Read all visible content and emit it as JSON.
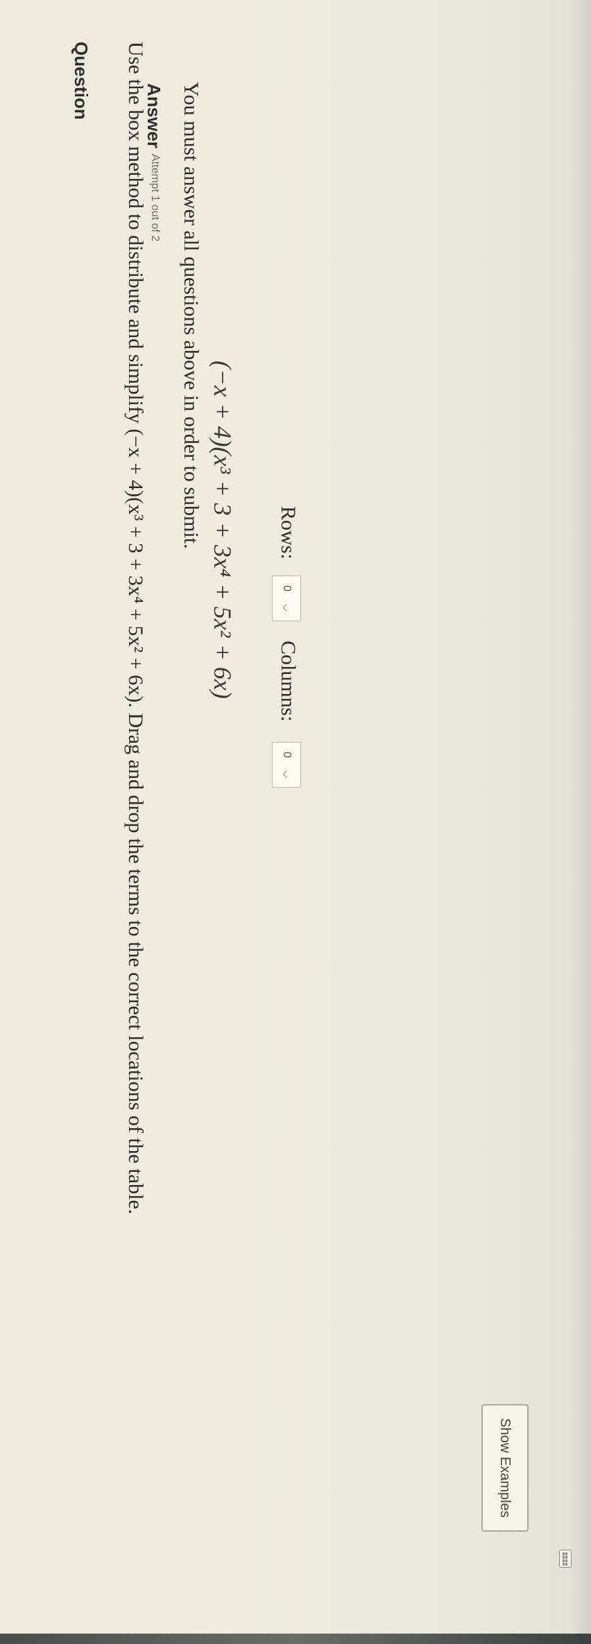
{
  "question": {
    "header": "Question",
    "show_examples_label": "Show Examples",
    "instruction_text": "Use the box method to distribute and simplify (−x + 4)(x³ + 3 + 3x⁴ + 5x² + 6x). Drag and drop the terms to the correct locations of the table.",
    "expression": "(−x + 4)(x³ + 3 + 3x⁴ + 5x² + 6x)"
  },
  "table_config": {
    "rows_label": "Rows:",
    "rows_value": "0",
    "columns_label": "Columns:",
    "columns_value": "0"
  },
  "answer": {
    "header": "Answer",
    "attempt_text": "Attempt 1 out of 2",
    "submit_message": "You must answer all questions above in order to submit."
  },
  "icons": {
    "keyboard": "keyboard-icon",
    "dropdown": "chevron-down-icon"
  },
  "colors": {
    "background": "#eeeadc",
    "math_accent": "#3b5c9a",
    "text": "#2a2a2a"
  }
}
